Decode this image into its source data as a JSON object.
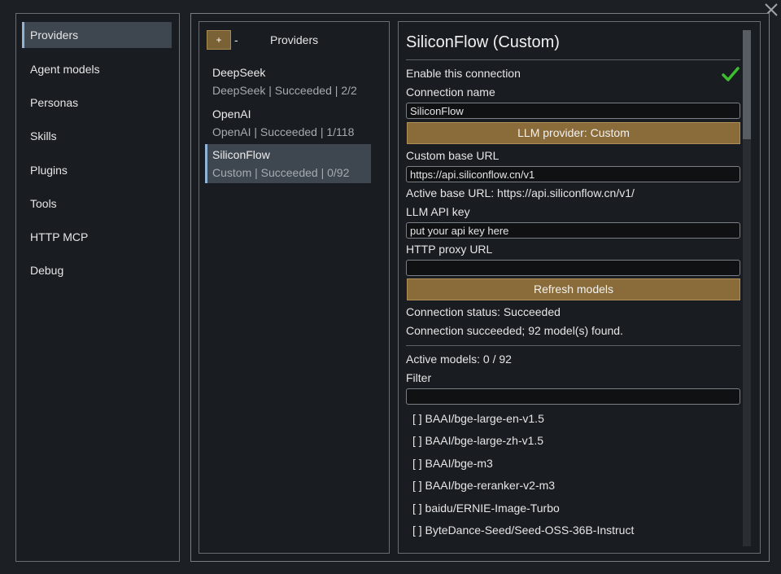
{
  "nav": {
    "items": [
      {
        "label": "Providers"
      },
      {
        "label": "Agent models"
      },
      {
        "label": "Personas"
      },
      {
        "label": "Skills"
      },
      {
        "label": "Plugins"
      },
      {
        "label": "Tools"
      },
      {
        "label": "HTTP MCP"
      },
      {
        "label": "Debug"
      }
    ],
    "active": "Providers"
  },
  "providers": {
    "add_label": "+",
    "remove_label": "-",
    "title": "Providers",
    "items": [
      {
        "name": "DeepSeek",
        "subtitle": "DeepSeek | Succeeded | 2/2"
      },
      {
        "name": "OpenAI",
        "subtitle": "OpenAI | Succeeded | 1/118"
      },
      {
        "name": "SiliconFlow",
        "subtitle": "Custom | Succeeded | 0/92"
      }
    ],
    "selected": "SiliconFlow"
  },
  "detail": {
    "title": "SiliconFlow (Custom)",
    "enable_label": "Enable this connection",
    "enabled": true,
    "connection_name_label": "Connection name",
    "connection_name_value": "SiliconFlow",
    "provider_button": "LLM provider: Custom",
    "base_url_label": "Custom base URL",
    "base_url_value": "https://api.siliconflow.cn/v1",
    "active_base_url": "Active base URL: https://api.siliconflow.cn/v1/",
    "api_key_label": "LLM API key",
    "api_key_value": "put your api key here",
    "proxy_label": "HTTP proxy URL",
    "proxy_value": "",
    "refresh_button": "Refresh models",
    "status": "Connection status: Succeeded",
    "status_detail": "Connection succeeded; 92 model(s) found.",
    "active_models": "Active models: 0 / 92",
    "filter_label": "Filter",
    "filter_value": "",
    "models": [
      "[ ] BAAI/bge-large-en-v1.5",
      "[ ] BAAI/bge-large-zh-v1.5",
      "[ ] BAAI/bge-m3",
      "[ ] BAAI/bge-reranker-v2-m3",
      "[ ] baidu/ERNIE-Image-Turbo",
      "[ ] ByteDance-Seed/Seed-OSS-36B-Instruct"
    ]
  },
  "colors": {
    "background": "#1c1f23",
    "panel": "#191c20",
    "accent_button": "#8a6b3a",
    "selection": "#3e4650",
    "selection_bar": "#8fb4d8",
    "check": "#3cbf2c"
  },
  "icons": {
    "close": "close-icon",
    "check": "checkmark-icon"
  }
}
